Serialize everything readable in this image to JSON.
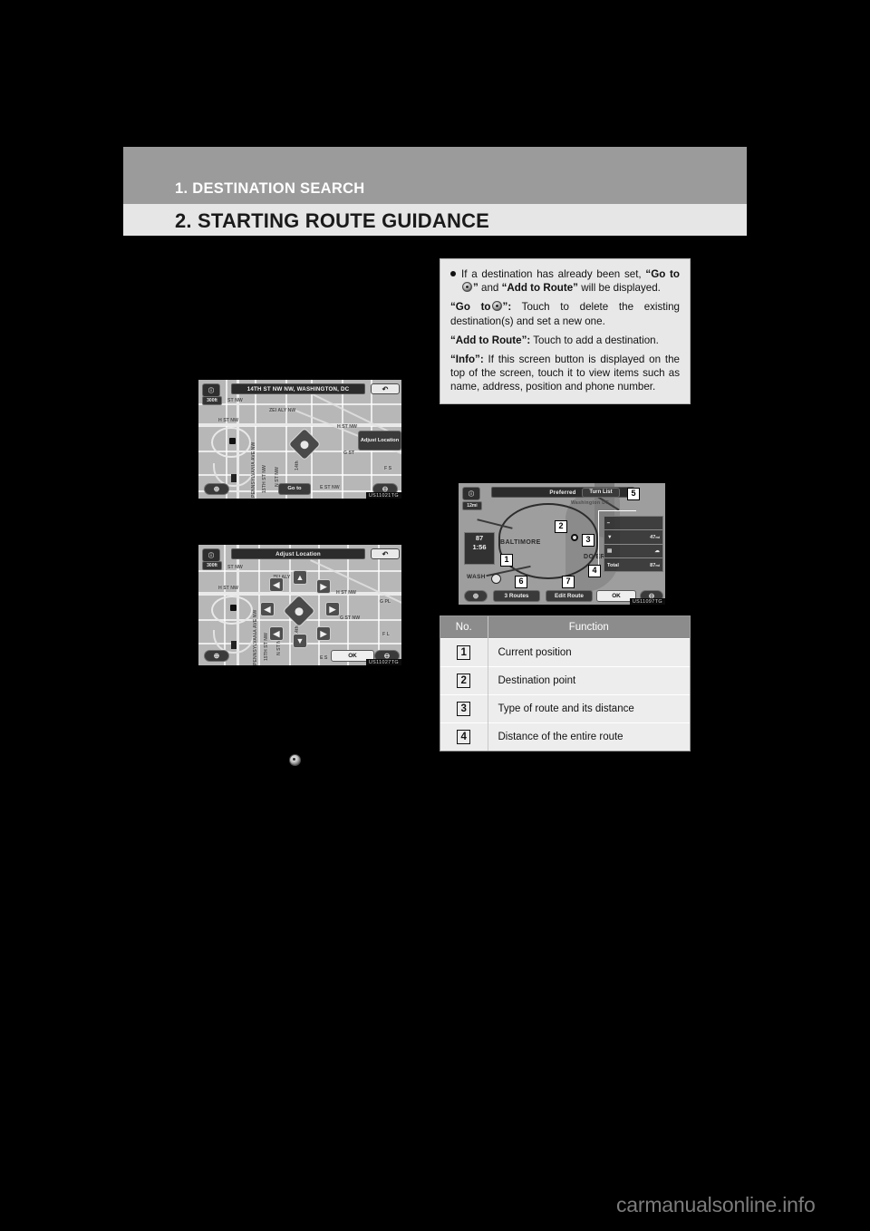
{
  "page": {
    "chapter_title": "1. DESTINATION SEARCH",
    "section_title": "2. STARTING ROUTE GUIDANCE",
    "watermark": "carmanualsonline.info",
    "colors": {
      "page_bg": "#000000",
      "chapter_band": "#9b9b9b",
      "section_band": "#e6e6e6",
      "info_box_bg": "#e8e8e8",
      "table_header": "#8c8c8c",
      "table_row": "#ededed"
    }
  },
  "info_box": {
    "bullet": {
      "pre": "If a destination has already been set,",
      "quote_open": "“Go to",
      "quote_close": "”",
      "and": "and",
      "add_to_route": "“Add to Route”",
      "post": "will be displayed."
    },
    "goto_entry": {
      "term_open": "“Go to",
      "term_close": "”:",
      "text": "Touch to delete the existing destination(s) and set a new one."
    },
    "add_entry": {
      "term": "“Add to Route”:",
      "text": "Touch to add a destination."
    },
    "info_entry": {
      "term": "“Info”:",
      "text": "If this screen button is displayed on the top of the screen, touch it to view items such as name, address, position and phone number."
    }
  },
  "figures": {
    "map_screen": {
      "code": "US11021TG",
      "title": "14TH ST NW NW, WASHINGTON, DC",
      "scale_label": "300ft",
      "adjust_button": "Adjust Location",
      "goto_button": "Go to",
      "back_icon": "back-arrow-icon",
      "zoom_in": "+",
      "zoom_out": "−",
      "info_icon": "info-icon",
      "streets": [
        "ST NW",
        "ZEI ALY NW",
        "H ST NW",
        "H ST NW",
        "G ST",
        "E ST NW",
        "F S",
        "14th",
        "N ST NW",
        "15TH ST NW",
        "PENNSYLVANIA AVE NW"
      ]
    },
    "adjust_screen": {
      "code": "US11027TG",
      "title": "Adjust Location",
      "scale_label": "300ft",
      "ok_button": "OK",
      "back_icon": "back-arrow-icon",
      "zoom_in": "+",
      "zoom_out": "−",
      "streets": [
        "ST NW",
        "ZEI ALY",
        "H ST NW",
        "H ST NW",
        "G PL",
        "G ST NW",
        "E S",
        "F L",
        "14th",
        "N ST NW",
        "15TH ST NW",
        "PENNSYLVANIA AVE NW"
      ]
    },
    "route_screen": {
      "code": "US11097TG",
      "route_type": "Preferred",
      "turn_list_button": "Turn List",
      "three_routes_button": "3 Routes",
      "edit_route_button": "Edit Route",
      "ok_button": "OK",
      "scale_label": "12mi",
      "eta": "1:56",
      "distance_badge": "87",
      "cities": [
        "BALTIMORE",
        "DO'ER",
        "WASH",
        "Washington DC"
      ],
      "panel_rows": [
        {
          "label": "",
          "value": ""
        },
        {
          "label": "preferred-route-icon",
          "value": "47 mi"
        },
        {
          "label": "alternate-route-icon",
          "value": ""
        },
        {
          "label": "total-label",
          "value": "87 mi"
        }
      ],
      "panel_total_label": "Total",
      "panel_total_value": "87",
      "panel_unit": "mi",
      "panel_alt_value": "47",
      "callouts": [
        "1",
        "2",
        "3",
        "4",
        "5",
        "6",
        "7"
      ]
    }
  },
  "function_table": {
    "headers": [
      "No.",
      "Function"
    ],
    "rows": [
      {
        "no": "1",
        "function": "Current position"
      },
      {
        "no": "2",
        "function": "Destination point"
      },
      {
        "no": "3",
        "function": "Type of route and its distance"
      },
      {
        "no": "4",
        "function": "Distance of the entire route"
      }
    ]
  }
}
